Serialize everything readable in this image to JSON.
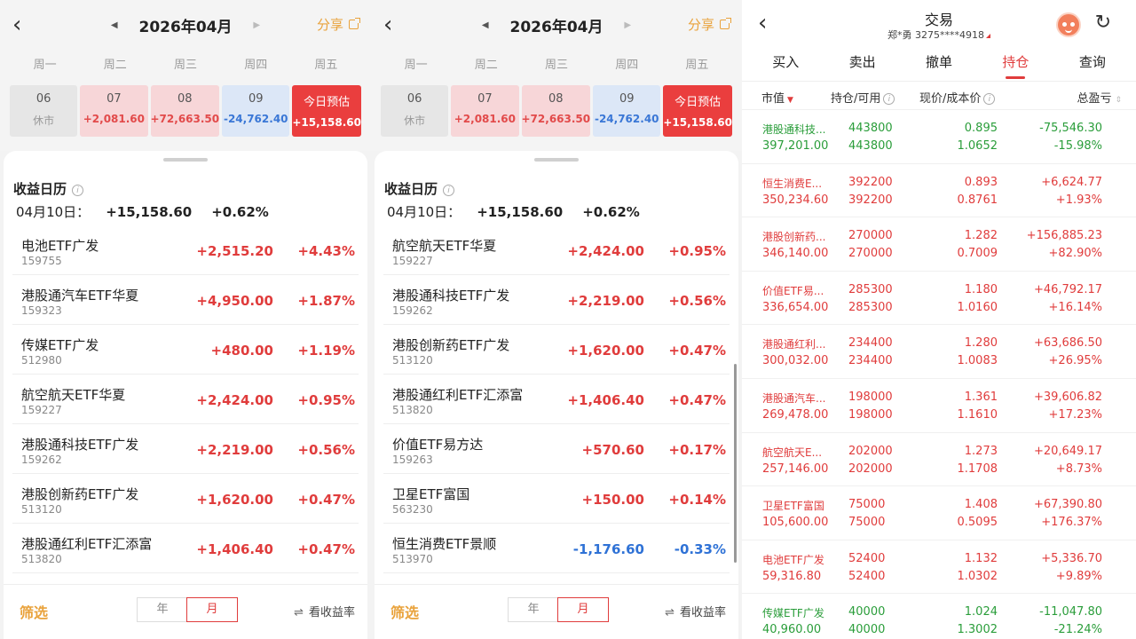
{
  "calendar": {
    "month_label": "2026年04月",
    "share_label": "分享",
    "weekdays": [
      "周一",
      "周二",
      "周三",
      "周四",
      "周五"
    ],
    "days": [
      {
        "date": "06",
        "value": "休市",
        "kind": "closed"
      },
      {
        "date": "07",
        "value": "+2,081.60",
        "kind": "up"
      },
      {
        "date": "08",
        "value": "+72,663.50",
        "kind": "up"
      },
      {
        "date": "09",
        "value": "-24,762.40",
        "kind": "down"
      },
      {
        "date": "今日预估",
        "value": "+15,158.60",
        "kind": "today"
      }
    ],
    "sheet_title": "收益日历",
    "summary": {
      "date": "04月10日：",
      "amount": "+15,158.60",
      "pct": "+0.62%"
    },
    "filter_label": "筛选",
    "segment": {
      "year": "年",
      "month": "月"
    },
    "view_rate_label": "看收益率"
  },
  "left_list": [
    {
      "name": "电池ETF广发",
      "code": "159755",
      "amount": "+2,515.20",
      "pct": "+4.43%",
      "dir": "up"
    },
    {
      "name": "港股通汽车ETF华夏",
      "code": "159323",
      "amount": "+4,950.00",
      "pct": "+1.87%",
      "dir": "up"
    },
    {
      "name": "传媒ETF广发",
      "code": "512980",
      "amount": "+480.00",
      "pct": "+1.19%",
      "dir": "up"
    },
    {
      "name": "航空航天ETF华夏",
      "code": "159227",
      "amount": "+2,424.00",
      "pct": "+0.95%",
      "dir": "up"
    },
    {
      "name": "港股通科技ETF广发",
      "code": "159262",
      "amount": "+2,219.00",
      "pct": "+0.56%",
      "dir": "up"
    },
    {
      "name": "港股创新药ETF广发",
      "code": "513120",
      "amount": "+1,620.00",
      "pct": "+0.47%",
      "dir": "up"
    },
    {
      "name": "港股通红利ETF汇添富",
      "code": "513820",
      "amount": "+1,406.40",
      "pct": "+0.47%",
      "dir": "up"
    }
  ],
  "middle_list": [
    {
      "name": "航空航天ETF华夏",
      "code": "159227",
      "amount": "+2,424.00",
      "pct": "+0.95%",
      "dir": "up"
    },
    {
      "name": "港股通科技ETF广发",
      "code": "159262",
      "amount": "+2,219.00",
      "pct": "+0.56%",
      "dir": "up"
    },
    {
      "name": "港股创新药ETF广发",
      "code": "513120",
      "amount": "+1,620.00",
      "pct": "+0.47%",
      "dir": "up"
    },
    {
      "name": "港股通红利ETF汇添富",
      "code": "513820",
      "amount": "+1,406.40",
      "pct": "+0.47%",
      "dir": "up"
    },
    {
      "name": "价值ETF易方达",
      "code": "159263",
      "amount": "+570.60",
      "pct": "+0.17%",
      "dir": "up"
    },
    {
      "name": "卫星ETF富国",
      "code": "563230",
      "amount": "+150.00",
      "pct": "+0.14%",
      "dir": "up"
    },
    {
      "name": "恒生消费ETF景顺",
      "code": "513970",
      "amount": "-1,176.60",
      "pct": "-0.33%",
      "dir": "down"
    }
  ],
  "trade": {
    "title": "交易",
    "account": "郑*勇 3275****4918",
    "tabs": [
      "买入",
      "卖出",
      "撤单",
      "持仓",
      "查询"
    ],
    "active_tab": 3,
    "headers": {
      "market_value": "市值",
      "position": "持仓/可用",
      "price_cost": "现价/成本价",
      "total_pl": "总盈亏"
    },
    "rows": [
      {
        "name": "港股通科技...",
        "mv": "397,201.00",
        "pos": "443800",
        "avail": "443800",
        "price": "0.895",
        "cost": "1.0652",
        "pl": "-75,546.30",
        "plp": "-15.98%",
        "dir": "down"
      },
      {
        "name": "恒生消费E...",
        "mv": "350,234.60",
        "pos": "392200",
        "avail": "392200",
        "price": "0.893",
        "cost": "0.8761",
        "pl": "+6,624.77",
        "plp": "+1.93%",
        "dir": "up"
      },
      {
        "name": "港股创新药...",
        "mv": "346,140.00",
        "pos": "270000",
        "avail": "270000",
        "price": "1.282",
        "cost": "0.7009",
        "pl": "+156,885.23",
        "plp": "+82.90%",
        "dir": "up"
      },
      {
        "name": "价值ETF易...",
        "mv": "336,654.00",
        "pos": "285300",
        "avail": "285300",
        "price": "1.180",
        "cost": "1.0160",
        "pl": "+46,792.17",
        "plp": "+16.14%",
        "dir": "up"
      },
      {
        "name": "港股通红利...",
        "mv": "300,032.00",
        "pos": "234400",
        "avail": "234400",
        "price": "1.280",
        "cost": "1.0083",
        "pl": "+63,686.50",
        "plp": "+26.95%",
        "dir": "up"
      },
      {
        "name": "港股通汽车...",
        "mv": "269,478.00",
        "pos": "198000",
        "avail": "198000",
        "price": "1.361",
        "cost": "1.1610",
        "pl": "+39,606.82",
        "plp": "+17.23%",
        "dir": "up"
      },
      {
        "name": "航空航天E...",
        "mv": "257,146.00",
        "pos": "202000",
        "avail": "202000",
        "price": "1.273",
        "cost": "1.1708",
        "pl": "+20,649.17",
        "plp": "+8.73%",
        "dir": "up"
      },
      {
        "name": "卫星ETF富国",
        "mv": "105,600.00",
        "pos": "75000",
        "avail": "75000",
        "price": "1.408",
        "cost": "0.5095",
        "pl": "+67,390.80",
        "plp": "+176.37%",
        "dir": "up"
      },
      {
        "name": "电池ETF广发",
        "mv": "59,316.80",
        "pos": "52400",
        "avail": "52400",
        "price": "1.132",
        "cost": "1.0302",
        "pl": "+5,336.70",
        "plp": "+9.89%",
        "dir": "up"
      },
      {
        "name": "传媒ETF广发",
        "mv": "40,960.00",
        "pos": "40000",
        "avail": "40000",
        "price": "1.024",
        "cost": "1.3002",
        "pl": "-11,047.80",
        "plp": "-21.24%",
        "dir": "down"
      }
    ]
  },
  "colors": {
    "up": "#e03c3c",
    "down_calendar": "#2f72d6",
    "down_trade": "#2a9d3a",
    "accent": "#e9a23b"
  }
}
